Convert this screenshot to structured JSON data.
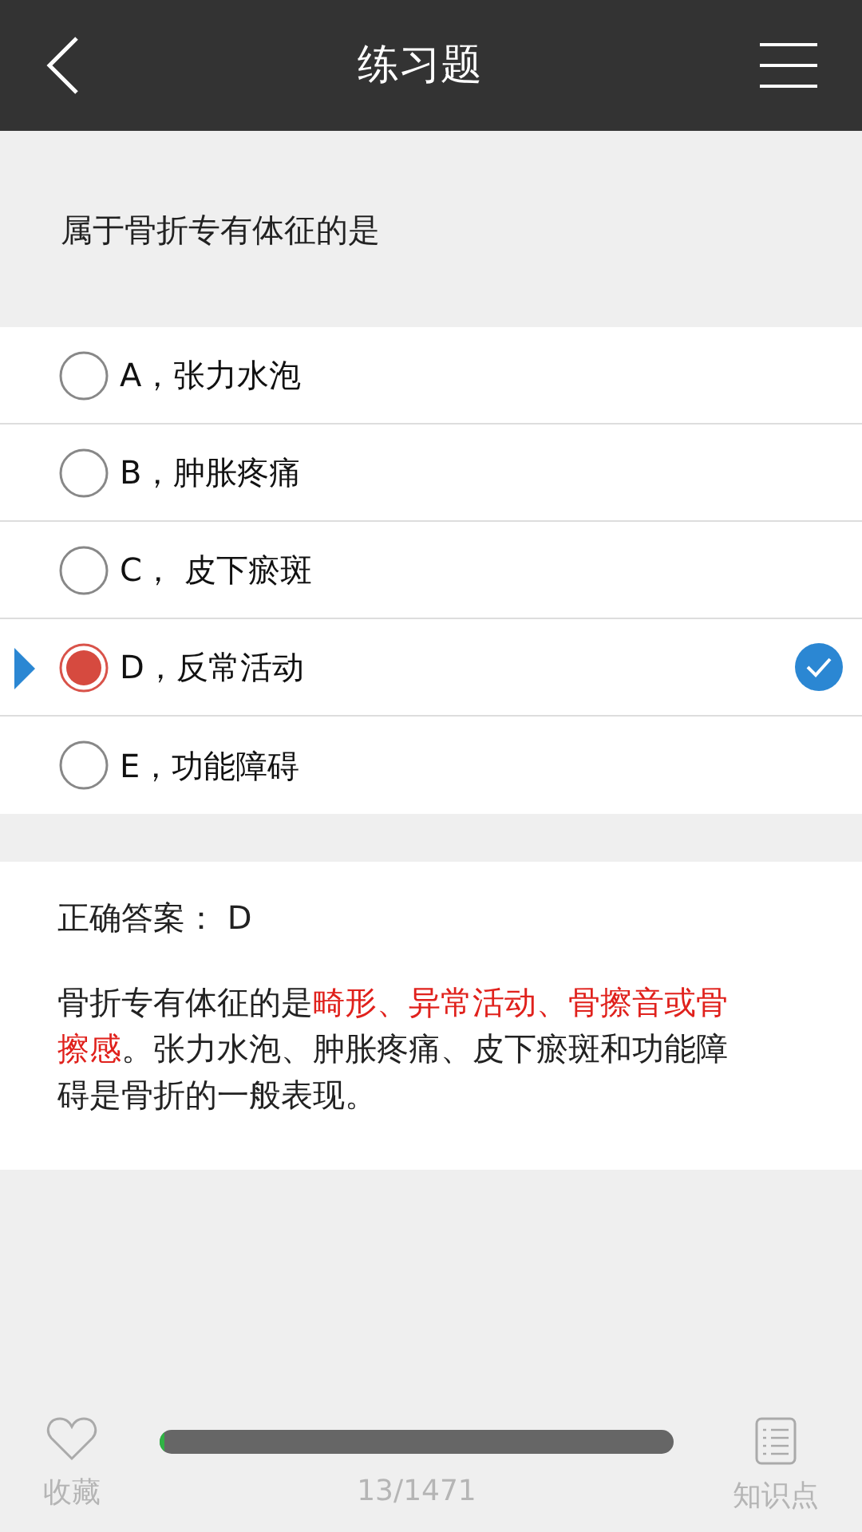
{
  "header": {
    "title": "练习题"
  },
  "question": "属于骨折专有体征的是",
  "options": [
    {
      "label": "A，张力水泡",
      "selected": false,
      "correct": false
    },
    {
      "label": "B，肿胀疼痛",
      "selected": false,
      "correct": false
    },
    {
      "label": "C， 皮下瘀斑",
      "selected": false,
      "correct": false
    },
    {
      "label": "D，反常活动",
      "selected": true,
      "correct": true
    },
    {
      "label": "E，功能障碍",
      "selected": false,
      "correct": false
    }
  ],
  "answer": {
    "label": "正确答案： D",
    "explanation": [
      {
        "text": "骨折专有体征的是",
        "highlight": false
      },
      {
        "text": "畸形、异常活动、骨擦音或骨擦感",
        "highlight": true
      },
      {
        "text": "。张力水泡、肿胀疼痛、皮下瘀斑和功能障碍是骨折的一般表现。",
        "highlight": false
      }
    ]
  },
  "bottom_bar": {
    "favorite": "收藏",
    "progress": {
      "level": 0.009,
      "text": "13/1471"
    },
    "knowledge": "知识点"
  }
}
